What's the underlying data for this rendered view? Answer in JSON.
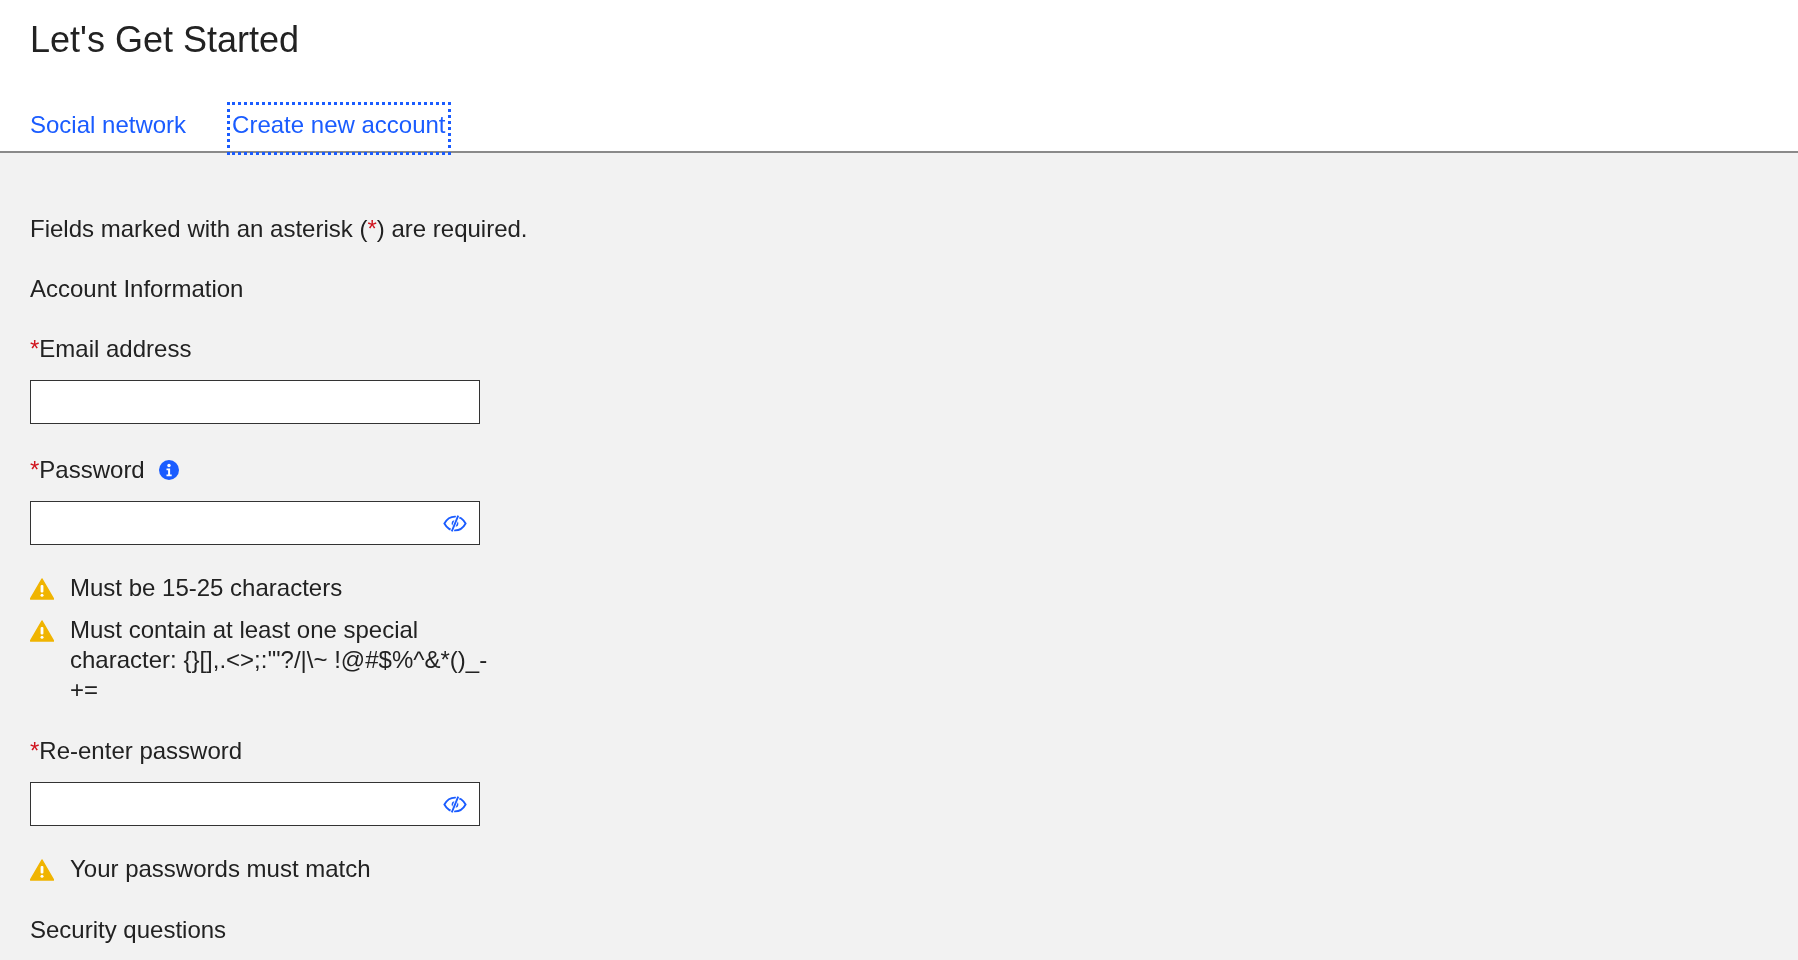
{
  "title": "Let's Get Started",
  "tabs": [
    {
      "label": "Social network",
      "selected": false
    },
    {
      "label": "Create new account",
      "selected": true
    }
  ],
  "note": {
    "before": "Fields marked with an asterisk (",
    "mark": "*",
    "after": ") are required."
  },
  "content": [
    {
      "kind": "heading",
      "text": "Account Information"
    },
    {
      "kind": "field",
      "label": "Email address",
      "required": true,
      "info": false,
      "reveal": false
    },
    {
      "kind": "field",
      "label": "Password",
      "required": true,
      "info": true,
      "reveal": true,
      "warnings": [
        "Must be 15-25 characters",
        "Must contain at least one special character: {}[],.<>;:'\"?/|\\~ !@#$%^&*()_-+="
      ]
    },
    {
      "kind": "field",
      "label": "Re-enter password",
      "required": true,
      "info": false,
      "reveal": true,
      "warnings": [
        "Your passwords must match"
      ]
    },
    {
      "kind": "heading",
      "text": "Security questions"
    }
  ]
}
